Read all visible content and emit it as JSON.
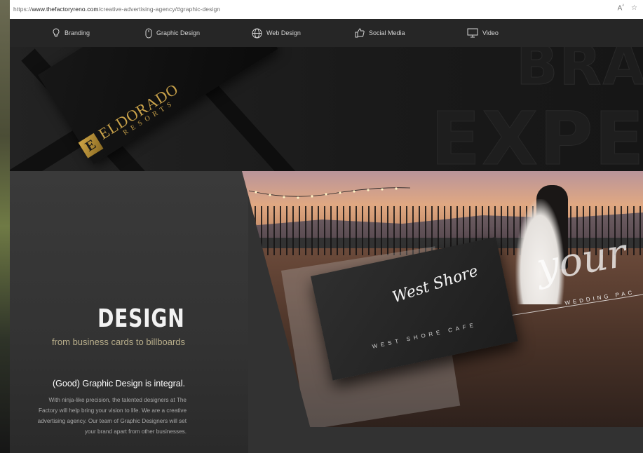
{
  "browser": {
    "url_prefix": "https://",
    "url_domain": "www.thefactoryreno.com",
    "url_path": "/creative-advertising-agency/#graphic-design",
    "icons": [
      "read-aloud-icon",
      "favorite-star-icon"
    ]
  },
  "nav": {
    "items": [
      {
        "label": "Branding",
        "icon": "lightbulb-icon"
      },
      {
        "label": "Graphic Design",
        "icon": "mouse-icon"
      },
      {
        "label": "Web Design",
        "icon": "globe-icon"
      },
      {
        "label": "Social Media",
        "icon": "thumbs-up-icon"
      },
      {
        "label": "Video",
        "icon": "monitor-icon"
      }
    ]
  },
  "hero": {
    "bg_word_1": "BRAN",
    "bg_word_2": "EXPERT",
    "card_brand": "ELDORADO",
    "card_brand_sub": "RESORTS",
    "card_mark": "E"
  },
  "design_section": {
    "title": "DESIGN",
    "subtitle": "from business cards to billboards",
    "heading": "(Good) Graphic Design is integral.",
    "body": "With ninja-like precision, the talented designers at The Factory will help bring your vision to life. We are a creative advertising agency. Our team of Graphic Designers will set your brand apart from other businesses."
  },
  "showcase": {
    "card_script": "West Shore",
    "card_tagline": "WEST SHORE CAFE",
    "photo_script": "your",
    "photo_caption": "WEDDING PAC"
  },
  "colors": {
    "nav_bg": "#262626",
    "accent_gold": "#c9a24a",
    "subtitle_tan": "#b7ad8a"
  }
}
